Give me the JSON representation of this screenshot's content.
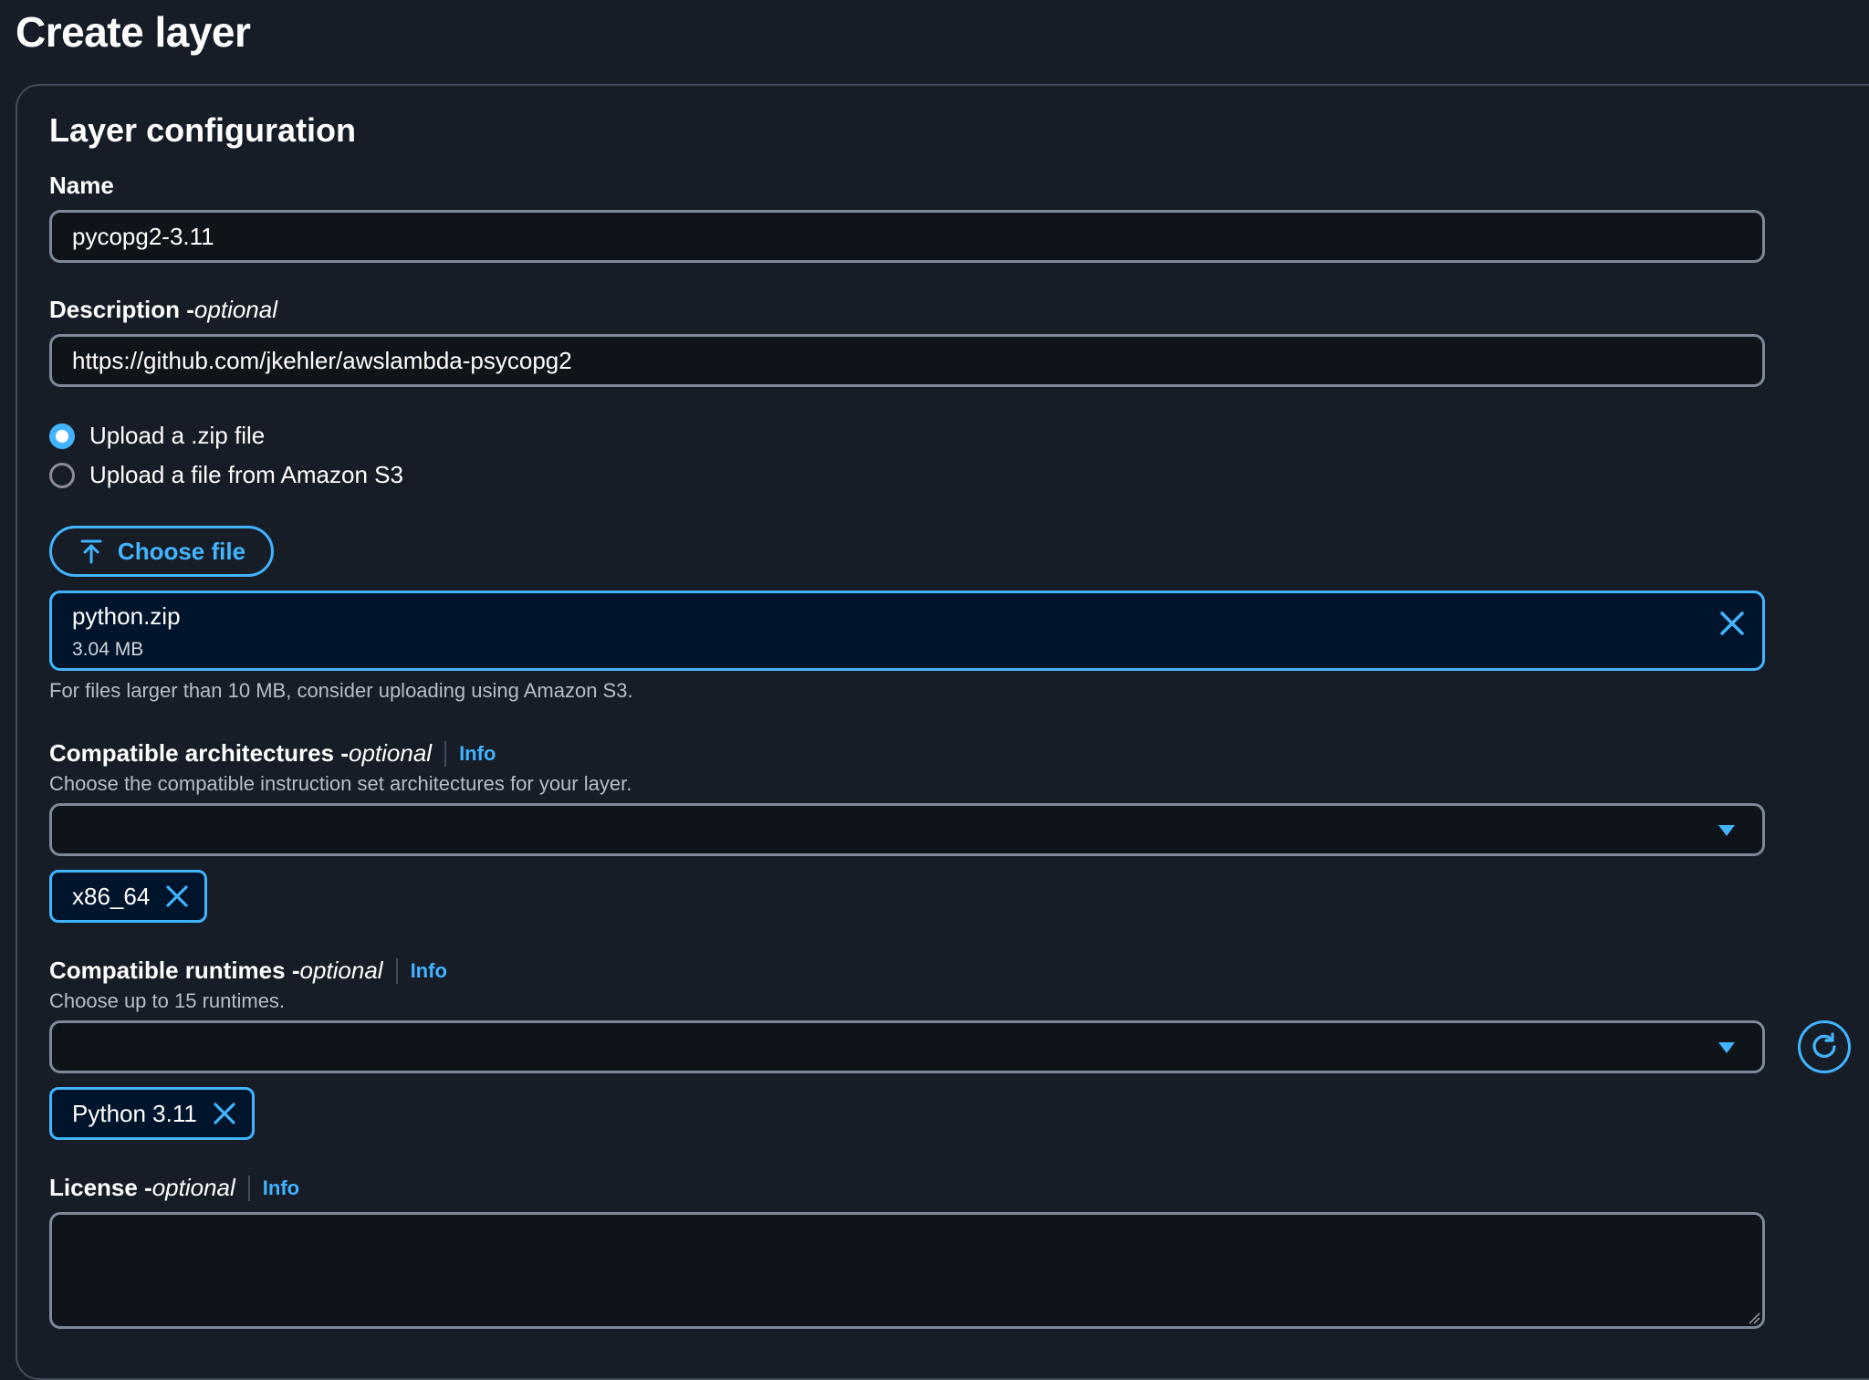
{
  "page": {
    "title": "Create layer"
  },
  "section": {
    "title": "Layer configuration"
  },
  "name_field": {
    "label": "Name",
    "value": "pycopg2-3.11"
  },
  "description_field": {
    "label": "Description - ",
    "optional": "optional",
    "value": "https://github.com/jkehler/awslambda-psycopg2"
  },
  "upload_options": [
    {
      "label": "Upload a .zip file",
      "selected": true
    },
    {
      "label": "Upload a file from Amazon S3",
      "selected": false
    }
  ],
  "choose_file": {
    "label": "Choose file",
    "icon": "upload-icon"
  },
  "selected_file": {
    "name": "python.zip",
    "size": "3.04 MB",
    "hint": "For files larger than 10 MB, consider uploading using Amazon S3."
  },
  "architectures": {
    "label": "Compatible architectures - ",
    "optional": "optional",
    "info": "Info",
    "description": "Choose the compatible instruction set architectures for your layer.",
    "selected_token": "x86_64"
  },
  "runtimes": {
    "label": "Compatible runtimes - ",
    "optional": "optional",
    "info": "Info",
    "description": "Choose up to 15 runtimes.",
    "selected_token": "Python 3.11"
  },
  "license": {
    "label": "License - ",
    "optional": "optional",
    "info": "Info",
    "value": ""
  },
  "colors": {
    "background": "#161d26",
    "accent": "#42b4ff",
    "border": "#7d8998",
    "token_bg": "#00142b"
  }
}
